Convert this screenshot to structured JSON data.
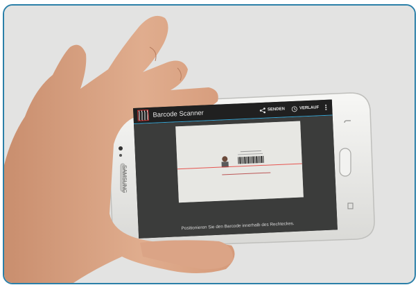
{
  "app": {
    "title": "Barcode Scanner",
    "actions": [
      {
        "label": "SENDEN",
        "icon": "share-icon"
      },
      {
        "label": "VERLAUF",
        "icon": "history-icon"
      }
    ],
    "overflow_icon": "overflow-menu-icon"
  },
  "viewfinder": {
    "hint": "Positionieren Sie den Barcode innerhalb des Rechteckes."
  },
  "phone": {
    "brand": "SAMSUNG"
  },
  "colors": {
    "frame_border": "#2a7fa8",
    "actionbar_accent": "#36a8d8",
    "scan_line": "#e63a35"
  }
}
